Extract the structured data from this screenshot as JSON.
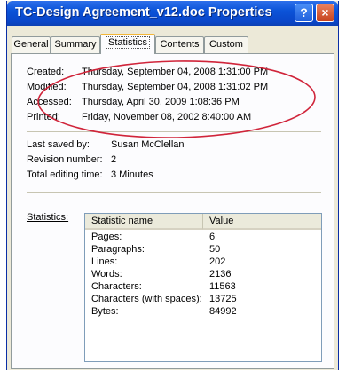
{
  "window": {
    "title": "TC-Design Agreement_v12.doc Properties"
  },
  "title_buttons": {
    "help": "?",
    "close": "×"
  },
  "tabs": [
    {
      "label": "General"
    },
    {
      "label": "Summary"
    },
    {
      "label": "Statistics"
    },
    {
      "label": "Contents"
    },
    {
      "label": "Custom"
    }
  ],
  "active_tab": "Statistics",
  "dates": [
    {
      "label": "Created:",
      "value": "Thursday, September 04, 2008 1:31:00 PM"
    },
    {
      "label": "Modified:",
      "value": "Thursday, September 04, 2008 1:31:02 PM"
    },
    {
      "label": "Accessed:",
      "value": "Thursday, April 30, 2009 1:08:36 PM"
    },
    {
      "label": "Printed:",
      "value": "Friday, November 08, 2002 8:40:00 AM"
    }
  ],
  "info": {
    "last_saved_label": "Last saved by:",
    "last_saved_value": "Susan McClellan",
    "revision_label": "Revision number:",
    "revision_value": "2",
    "editing_label": "Total editing time:",
    "editing_value": "3 Minutes"
  },
  "statistics": {
    "label": "Statistics:",
    "columns": [
      "Statistic name",
      "Value"
    ],
    "rows": [
      {
        "name": "Pages:",
        "value": "6"
      },
      {
        "name": "Paragraphs:",
        "value": "50"
      },
      {
        "name": "Lines:",
        "value": "202"
      },
      {
        "name": "Words:",
        "value": "2136"
      },
      {
        "name": "Characters:",
        "value": "11563"
      },
      {
        "name": "Characters (with spaces):",
        "value": "13725"
      },
      {
        "name": "Bytes:",
        "value": "84992"
      }
    ]
  },
  "colors": {
    "annotation_ellipse": "#d0243a",
    "titlebar": "#0b53d8",
    "dialog_bg": "#ece9d8"
  }
}
